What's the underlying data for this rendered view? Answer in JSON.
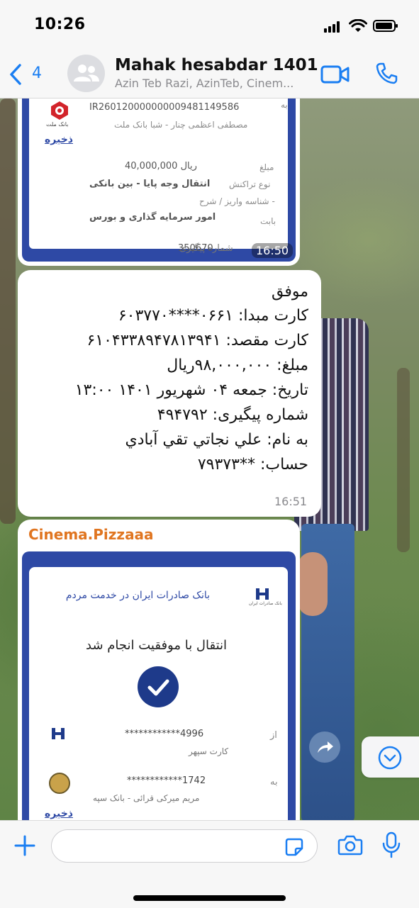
{
  "status_bar": {
    "time": "10:26"
  },
  "header": {
    "back_count": "4",
    "title": "Mahak hesabdar 1401",
    "subtitle": "Azin Teb Razi, AzinTeb, Cinem..."
  },
  "messages": {
    "receipt1": {
      "to_label": "به",
      "iban": "IR260120000000009481149586",
      "recipient": "مصطفی اعظمی چنار - شبا بانک ملت",
      "bank_logo_text": "بانک ملت",
      "save_label": "ذخیره",
      "amount_label": "مبلغ",
      "amount_value": "40,000,000 ریال",
      "type_label": "نوع تراکنش",
      "type_value": "انتقال وجه پایا - بین بانکی",
      "deposit_label": "شناسه واریز / شرح -",
      "for_label": "بابت",
      "for_value": "امور سرمایه گذاری و بورس",
      "tracking_label": "شماره پیگیری",
      "tracking_value": "350670",
      "time": "16:50"
    },
    "text_message": {
      "lines": [
        "موفق",
        "کارت مبدا: ۰۶۶۱****۶۰۳۷۷۰",
        "کارت مقصد: ۶۱۰۴۳۳۸۹۴۷۸۱۳۹۴۱",
        "مبلغ: ۹۸,۰۰۰,۰۰۰ریال",
        "تاریخ: جمعه ۰۴ شهریور ۱۴۰۱ ۱۳:۰۰",
        "شماره پیگیری: ۴۹۴۷۹۲",
        "به نام: علي نجاتي تقي آبادي",
        "حساب: **۷۹۳۷۳"
      ],
      "time": "16:51"
    },
    "receipt2": {
      "sender": "Cinema.Pizzaaa",
      "bank_name": "بانک صادرات ایران در خدمت مردم",
      "bank_logo_text": "بانک صادرات ایران",
      "success_text": "انتقال با موفقیت انجام شد",
      "from_label": "از",
      "from_card": "************4996",
      "from_card_name": "کارت سپهر",
      "to_label": "به",
      "to_card": "************1742",
      "to_name": "مریم میرکی  قرائی - بانک سپه",
      "save_label": "ذخیره"
    }
  },
  "colors": {
    "accent": "#1a7ef2",
    "sender_name": "#e07520",
    "bank_blue": "#2e49a5"
  }
}
